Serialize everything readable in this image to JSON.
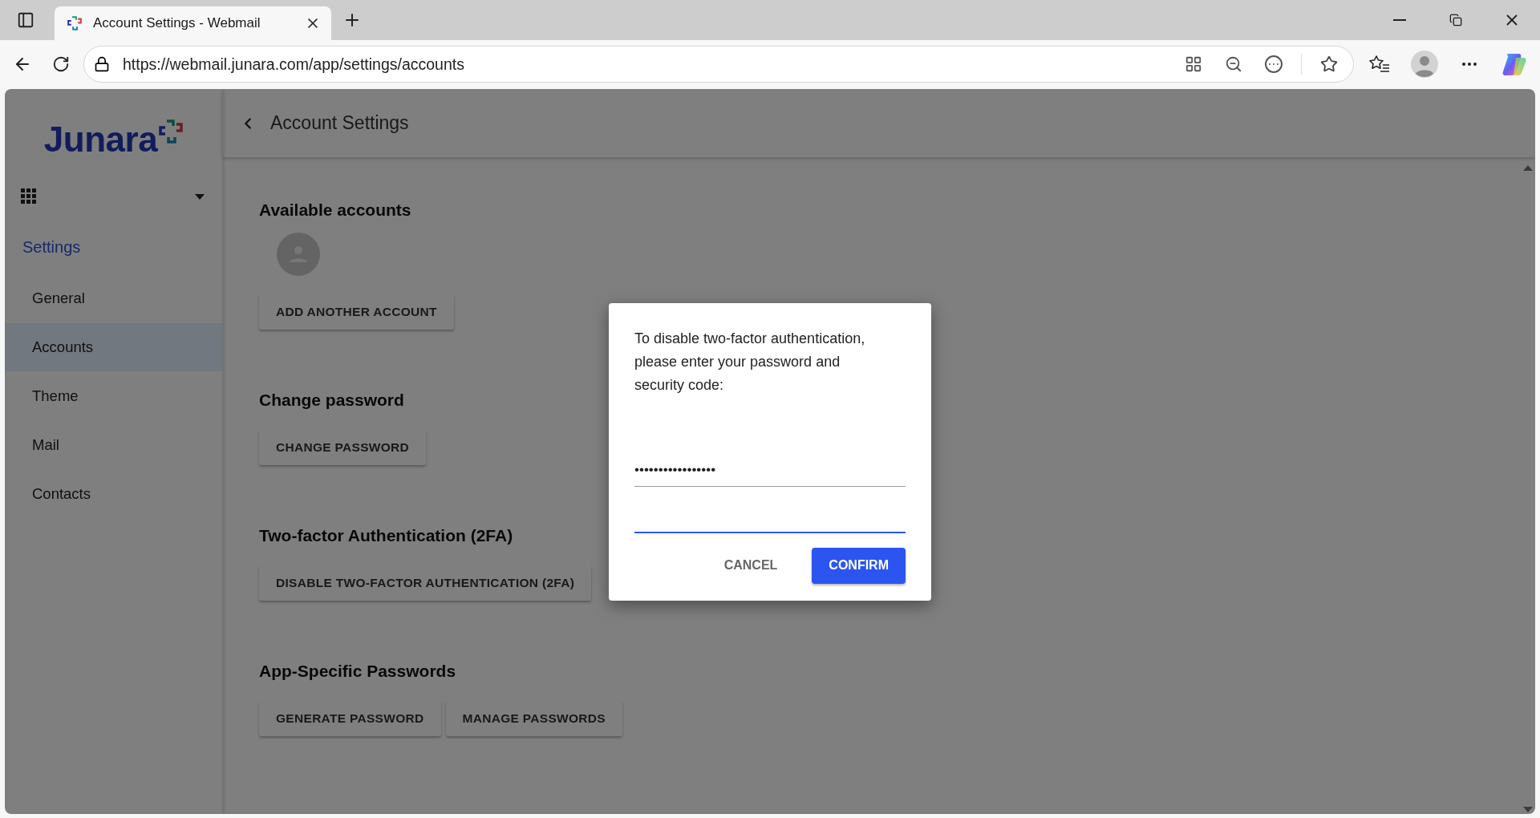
{
  "browser": {
    "tab_title": "Account Settings - Webmail",
    "url": "https://webmail.junara.com/app/settings/accounts"
  },
  "sidebar": {
    "logo": "Junara",
    "section": "Settings",
    "items": [
      {
        "label": "General",
        "selected": false
      },
      {
        "label": "Accounts",
        "selected": true
      },
      {
        "label": "Theme",
        "selected": false
      },
      {
        "label": "Mail",
        "selected": false
      },
      {
        "label": "Contacts",
        "selected": false
      }
    ]
  },
  "header": {
    "title": "Account Settings"
  },
  "sections": [
    {
      "heading": "Available accounts",
      "kind": "accounts",
      "buttons": [
        "ADD ANOTHER ACCOUNT"
      ]
    },
    {
      "heading": "Change password",
      "kind": "actions",
      "buttons": [
        "CHANGE PASSWORD"
      ]
    },
    {
      "heading": "Two-factor Authentication (2FA)",
      "kind": "actions",
      "buttons": [
        "DISABLE TWO-FACTOR AUTHENTICATION (2FA)"
      ]
    },
    {
      "heading": "App-Specific Passwords",
      "kind": "actions",
      "buttons": [
        "GENERATE PASSWORD",
        "MANAGE PASSWORDS"
      ]
    }
  ],
  "dialog": {
    "message": "To disable two-factor authentication, please enter your password and security code:",
    "fields": [
      {
        "value": "•••••••••••••••••",
        "focused": false
      },
      {
        "focused": true
      }
    ],
    "buttons": [
      {
        "label": "CANCEL",
        "kind": "text"
      },
      {
        "label": "CONFIRM",
        "kind": "primary"
      }
    ]
  }
}
